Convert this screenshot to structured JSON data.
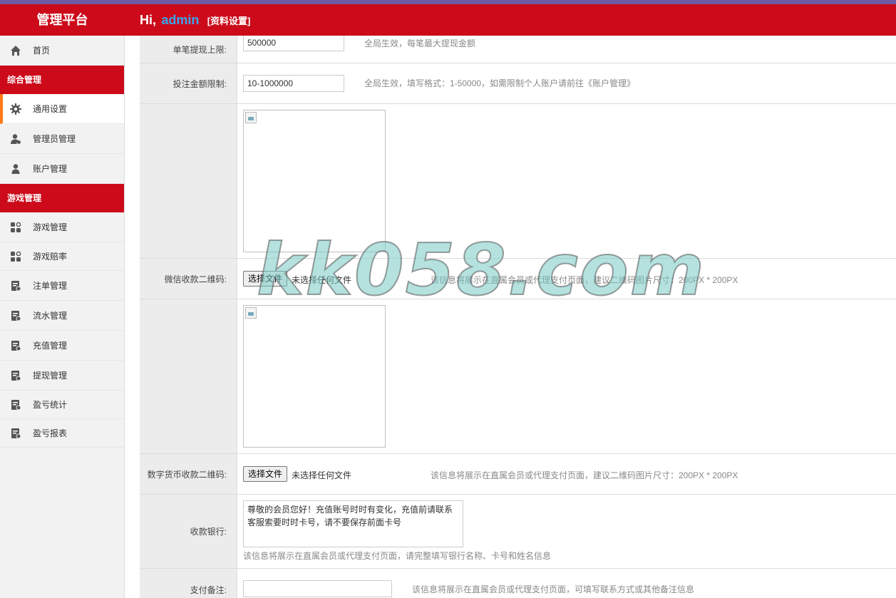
{
  "header": {
    "brand": "管理平台",
    "greeting": "Hi,",
    "username": "admin",
    "profile_link": "[资料设置]",
    "colors": {
      "bar": "#cc0a1a",
      "top_strip": "#6f5aa5",
      "username": "#39a7f0"
    }
  },
  "sidebar": {
    "home": {
      "label": "首页",
      "icon": "home-icon"
    },
    "group1": "综合管理",
    "general_settings": {
      "label": "通用设置",
      "icon": "gear-icon"
    },
    "admin_mgmt": {
      "label": "管理员管理",
      "icon": "admin-user-icon"
    },
    "account_mgmt": {
      "label": "账户管理",
      "icon": "user-icon"
    },
    "group2": "游戏管理",
    "game_mgmt": {
      "label": "游戏管理",
      "icon": "grid-icon"
    },
    "game_odds": {
      "label": "游戏赔率",
      "icon": "grid-icon"
    },
    "bet_mgmt": {
      "label": "注单管理",
      "icon": "ledger-icon"
    },
    "flow_mgmt": {
      "label": "流水管理",
      "icon": "ledger-icon"
    },
    "recharge_mgmt": {
      "label": "充值管理",
      "icon": "ledger-icon"
    },
    "withdraw_mgmt": {
      "label": "提现管理",
      "icon": "ledger-icon"
    },
    "profit_stats": {
      "label": "盈亏统计",
      "icon": "ledger-icon"
    },
    "profit_report": {
      "label": "盈亏报表",
      "icon": "ledger-icon"
    },
    "colors": {
      "group_bg": "#cc0a1a",
      "active_indicator": "#ff7a1a"
    }
  },
  "form": {
    "max_withdraw": {
      "label": "单笔提现上限:",
      "value": "500000",
      "hint": "全局生效，每笔最大提现金额"
    },
    "bet_limit": {
      "label": "投注金额限制:",
      "value": "10-1000000",
      "hint": "全局生效，填写格式：1-50000，如需限制个人账户请前往《账户管理》"
    },
    "wechat_qr": {
      "label": "微信收款二维码:",
      "button": "选择文件",
      "status": "未选择任何文件",
      "hint": "该信息将展示在直属会员或代理支付页面，建议二维码图片尺寸：200PX * 200PX"
    },
    "crypto_qr": {
      "label": "数字货币收款二维码:",
      "button": "选择文件",
      "status": "未选择任何文件",
      "hint": "该信息将展示在直属会员或代理支付页面，建议二维码图片尺寸：200PX * 200PX"
    },
    "bank": {
      "label": "收款银行:",
      "value": "尊敬的会员您好！充值账号时时有变化，充值前请联系客服索要时时卡号，请不要保存前面卡号",
      "hint": "该信息将展示在直属会员或代理支付页面，请完整填写银行名称、卡号和姓名信息"
    },
    "payment_note": {
      "label": "支付备注:",
      "value": "",
      "hint": "该信息将展示在直属会员或代理支付页面，可填写联系方式或其他备注信息"
    }
  },
  "watermark": "kk058.com"
}
